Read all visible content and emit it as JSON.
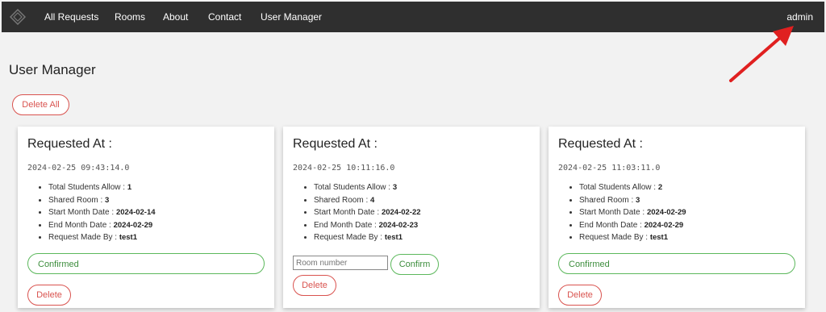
{
  "nav": {
    "links": [
      "All Requests",
      "Rooms",
      "About",
      "Contact",
      "User Manager"
    ],
    "user": "admin"
  },
  "page": {
    "title": "User Manager",
    "delete_all_label": "Delete All"
  },
  "cards": [
    {
      "title": "Requested At :",
      "timestamp": "2024-02-25 09:43:14.0",
      "details": [
        {
          "label": "Total Students Allow :",
          "value": "1"
        },
        {
          "label": "Shared Room :",
          "value": "3"
        },
        {
          "label": "Start Month Date :",
          "value": "2024-02-14"
        },
        {
          "label": "End Month Date :",
          "value": "2024-02-29"
        },
        {
          "label": "Request Made By :",
          "value": "test1"
        }
      ],
      "status": "Confirmed",
      "delete_label": "Delete"
    },
    {
      "title": "Requested At :",
      "timestamp": "2024-02-25 10:11:16.0",
      "details": [
        {
          "label": "Total Students Allow :",
          "value": "3"
        },
        {
          "label": "Shared Room :",
          "value": "4"
        },
        {
          "label": "Start Month Date :",
          "value": "2024-02-22"
        },
        {
          "label": "End Month Date :",
          "value": "2024-02-23"
        },
        {
          "label": "Request Made By :",
          "value": "test1"
        }
      ],
      "room_placeholder": "Room number",
      "confirm_label": "Confirm",
      "delete_label": "Delete"
    },
    {
      "title": "Requested At :",
      "timestamp": "2024-02-25 11:03:11.0",
      "details": [
        {
          "label": "Total Students Allow :",
          "value": "2"
        },
        {
          "label": "Shared Room :",
          "value": "3"
        },
        {
          "label": "Start Month Date :",
          "value": "2024-02-29"
        },
        {
          "label": "End Month Date :",
          "value": "2024-02-29"
        },
        {
          "label": "Request Made By :",
          "value": "test1"
        }
      ],
      "status": "Confirmed",
      "delete_label": "Delete"
    }
  ],
  "icons": {
    "logo": "diamond-logo-icon",
    "annotation": "red-arrow-icon"
  },
  "colors": {
    "navbar": "#2f2f2f",
    "danger": "#d9534f",
    "success": "#5cb85c",
    "annotation_arrow": "#e02020"
  }
}
